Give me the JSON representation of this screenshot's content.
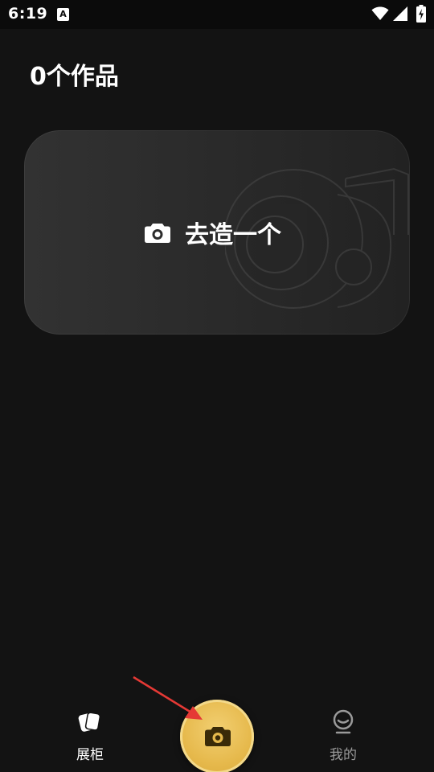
{
  "status_bar": {
    "time": "6:19",
    "notification_glyph": "A",
    "icons": [
      "wifi-icon",
      "signal-icon",
      "battery-charging-icon"
    ]
  },
  "header": {
    "title": "0个作品"
  },
  "create_card": {
    "label": "去造一个",
    "icon": "camera-icon"
  },
  "bottom_nav": {
    "items": [
      {
        "label": "展柜",
        "icon": "cards-icon",
        "active": true
      },
      {
        "label": "我的",
        "icon": "profile-icon",
        "active": false
      }
    ],
    "center_button": {
      "icon": "camera-icon"
    }
  },
  "colors": {
    "background": "#131313",
    "accent": "#E6B94C",
    "card": "#2B2B2B",
    "inactive_text": "#9A9A9A",
    "annotation_arrow": "#E53935"
  }
}
